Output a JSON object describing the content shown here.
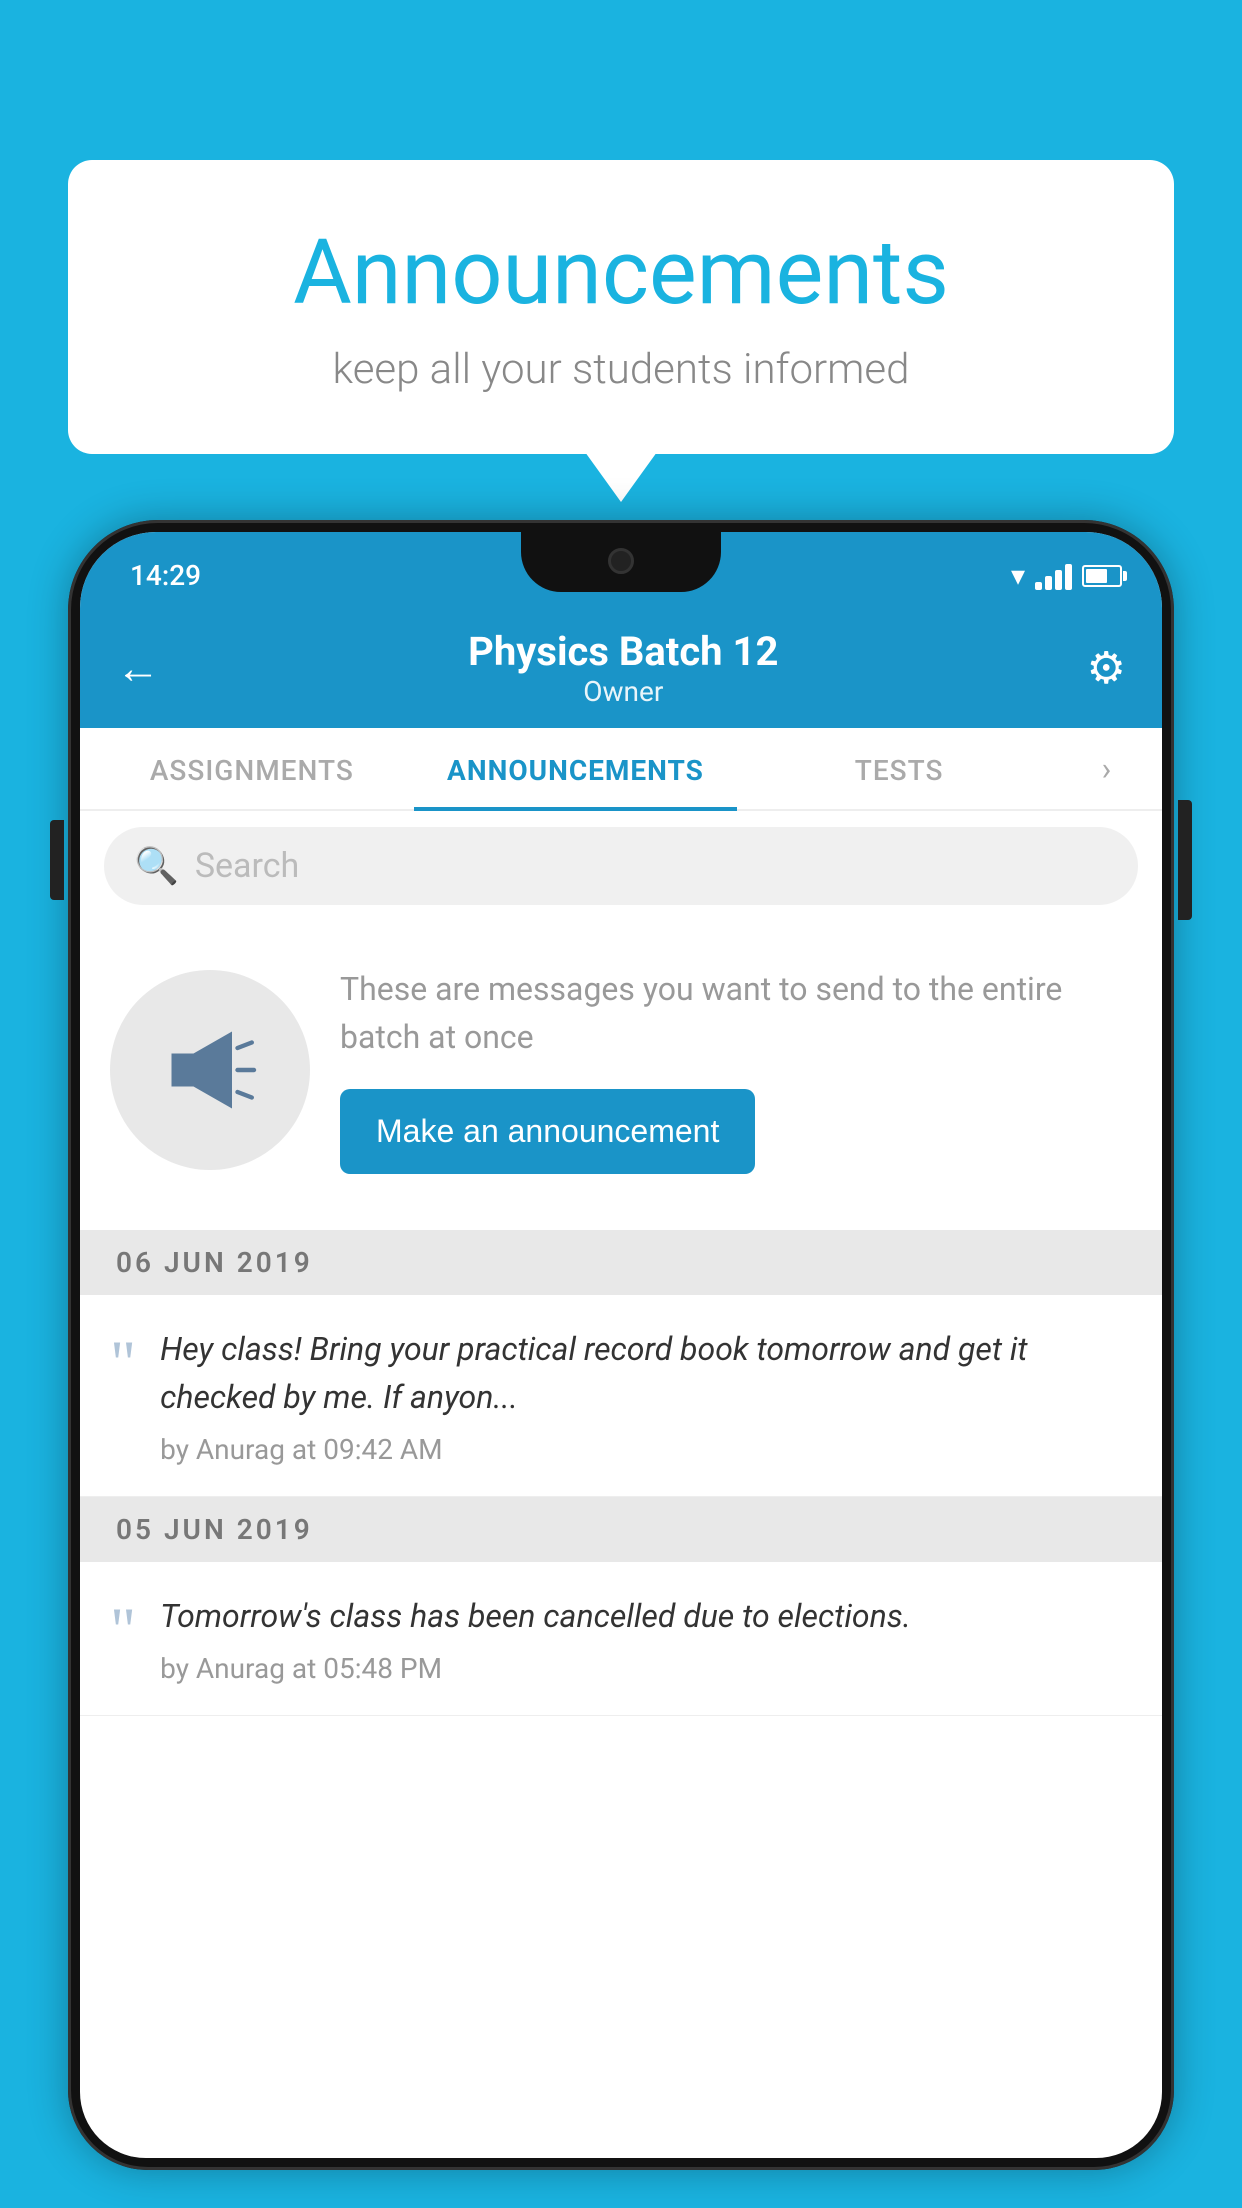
{
  "background": {
    "color": "#1ab3e0"
  },
  "speech_bubble": {
    "title": "Announcements",
    "subtitle": "keep all your students informed"
  },
  "phone": {
    "status_bar": {
      "time": "14:29"
    },
    "header": {
      "title": "Physics Batch 12",
      "subtitle": "Owner",
      "back_label": "←",
      "gear_label": "⚙"
    },
    "tabs": [
      {
        "label": "ASSIGNMENTS",
        "active": false
      },
      {
        "label": "ANNOUNCEMENTS",
        "active": true
      },
      {
        "label": "TESTS",
        "active": false
      }
    ],
    "search": {
      "placeholder": "Search"
    },
    "announcement_prompt": {
      "description": "These are messages you want to send to the entire batch at once",
      "button_label": "Make an announcement"
    },
    "announcements": [
      {
        "date": "06  JUN  2019",
        "text": "Hey class! Bring your practical record book tomorrow and get it checked by me. If anyon...",
        "meta": "by Anurag at 09:42 AM"
      },
      {
        "date": "05  JUN  2019",
        "text": "Tomorrow's class has been cancelled due to elections.",
        "meta": "by Anurag at 05:48 PM"
      }
    ]
  }
}
